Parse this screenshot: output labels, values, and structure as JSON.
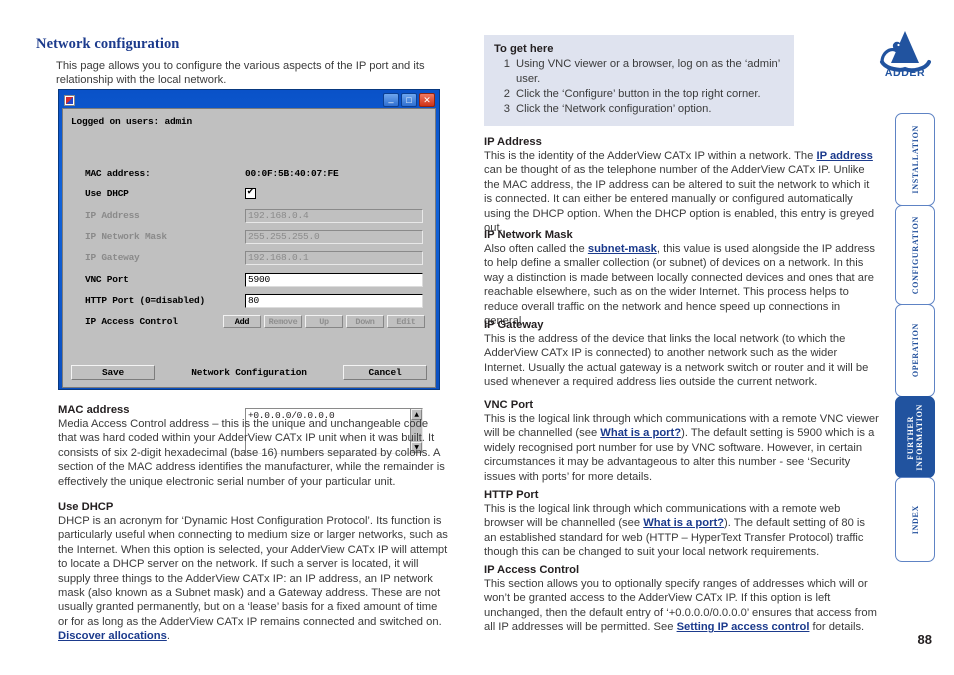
{
  "page": {
    "title": "Network configuration",
    "intro": "This page allows you to configure the various aspects of the IP port and its relationship with the local network.",
    "number": "88"
  },
  "to_get_here": {
    "title": "To get here",
    "steps": [
      {
        "num": "1",
        "text": "Using VNC viewer or a browser, log on as the ‘admin’ user."
      },
      {
        "num": "2",
        "text": "Click the ‘Configure’ button in the top right corner."
      },
      {
        "num": "3",
        "text": "Click the ‘Network configuration’ option."
      }
    ]
  },
  "dialog": {
    "window_buttons": {
      "minimize": "_",
      "maximize": "□",
      "close": "✕"
    },
    "logged_on": "Logged on users: admin",
    "footer_title": "Network Configuration",
    "save_label": "Save",
    "cancel_label": "Cancel",
    "fields": [
      {
        "label": "MAC address:",
        "value": "00:0F:5B:40:07:FE",
        "type": "static",
        "disabled": false
      },
      {
        "label": "Use DHCP",
        "value": "checked",
        "type": "checkbox",
        "disabled": false
      },
      {
        "label": "IP Address",
        "value": "192.168.0.4",
        "type": "input",
        "disabled": true
      },
      {
        "label": "IP Network Mask",
        "value": "255.255.255.0",
        "type": "input",
        "disabled": true
      },
      {
        "label": "IP Gateway",
        "value": "192.168.0.1",
        "type": "input",
        "disabled": true
      },
      {
        "label": "VNC Port",
        "value": "5900",
        "type": "input",
        "disabled": false
      },
      {
        "label": "HTTP Port (0=disabled)",
        "value": "80",
        "type": "input",
        "disabled": false
      },
      {
        "label": "IP Access Control",
        "value": "",
        "type": "buttons",
        "disabled": false
      }
    ],
    "acl_buttons": [
      {
        "label": "Add",
        "disabled": false
      },
      {
        "label": "Remove",
        "disabled": true
      },
      {
        "label": "Up",
        "disabled": true
      },
      {
        "label": "Down",
        "disabled": true
      },
      {
        "label": "Edit",
        "disabled": true
      }
    ],
    "acl_entries": [
      "+0.0.0.0/0.0.0.0"
    ],
    "scroll_up": "▲",
    "scroll_down": "▼"
  },
  "left_sections": [
    {
      "heading": "MAC address",
      "body": "Media Access Control address – this is the unique and unchangeable code that was hard coded within your AdderView CATx IP unit when it was built. It consists of six 2-digit hexadecimal (base 16) numbers separated by colons. A section of the MAC address identifies the manufacturer, while the remainder is effectively the unique electronic serial number of your particular unit."
    },
    {
      "heading": "Use DHCP",
      "body_pre": "DHCP is an acronym for ‘Dynamic Host Configuration Protocol’. Its function is particularly useful when connecting to medium size or larger networks, such as the Internet. When this option is selected, your AdderView CATx IP will attempt to locate a DHCP server on the network. If such a server is located, it will supply three things to the AdderView CATx IP: an IP address, an IP network mask (also known as a Subnet mask) and a Gateway address. These are not usually granted permanently, but on a ‘lease’ basis for a fixed amount of time or for as long as the AdderView CATx IP remains connected and switched on. ",
      "link": "Discover allocations",
      "body_post": "."
    }
  ],
  "right_sections": [
    {
      "heading": "IP Address",
      "body_pre": "This is the identity of the AdderView CATx IP within a network. The ",
      "link": "IP address",
      "body_post": " can be thought of as the telephone number of the AdderView CATx IP. Unlike the MAC address, the IP address can be altered to suit the network to which it is connected. It can either be entered manually or configured automatically using the DHCP option. When the DHCP option is enabled, this entry is greyed out."
    },
    {
      "heading": "IP Network Mask",
      "body_pre": "Also often called the ",
      "link": "subnet-mask",
      "body_post": ", this value is used alongside the IP address to help define a smaller collection (or subnet) of devices on a network. In this way a distinction is made between locally connected devices and ones that are reachable elsewhere, such as on the wider Internet. This process helps to reduce overall traffic on the network and hence speed up connections in general."
    },
    {
      "heading": "IP Gateway",
      "body_pre": "This is the address of the device that links the local network (to which the AdderView CATx IP is connected) to another network such as the wider Internet. Usually the actual gateway is a network switch or router and it will be used whenever a required address lies outside the current network.",
      "link": "",
      "body_post": ""
    },
    {
      "heading": "VNC Port",
      "body_pre": "This is the logical link through which communications with a remote VNC viewer will be channelled (see ",
      "link": "What is a port?",
      "body_post": "). The default setting is 5900 which is a widely recognised port number for use by VNC software. However, in certain circumstances it may be advantageous to alter this number - see ‘Security issues with ports’ for more details."
    },
    {
      "heading": "HTTP Port",
      "body_pre": "This is the logical link through which communications with a remote web browser will be channelled (see ",
      "link": "What is a port?",
      "body_post": "). The default setting of 80 is an established standard for web (HTTP – HyperText Transfer Protocol) traffic though this can be changed to suit your local network requirements."
    },
    {
      "heading": "IP Access Control",
      "body_pre": "This section allows you to optionally specify ranges of addresses which will or won’t be granted access to the AdderView CATx IP. If this option is left unchanged, then the default entry of ‘+0.0.0.0/0.0.0.0’ ensures that access from all IP addresses will be permitted. See ",
      "link": "Setting IP access control",
      "body_post": " for details."
    }
  ],
  "sidebar": {
    "tabs": [
      {
        "label": "INSTALLATION",
        "active": false
      },
      {
        "label": "CONFIGURATION",
        "active": false
      },
      {
        "label": "OPERATION",
        "active": false
      },
      {
        "label": "FURTHER\nINFORMATION",
        "active": true
      },
      {
        "label": "INDEX",
        "active": false
      }
    ]
  },
  "logo": {
    "text": "ADDER",
    "trademark": "®"
  },
  "colors": {
    "brand_blue": "#21539f",
    "heading_blue": "#1b3a8c",
    "callout_bg": "#dfe3ef",
    "dialog_gray": "#c0c0c0"
  }
}
